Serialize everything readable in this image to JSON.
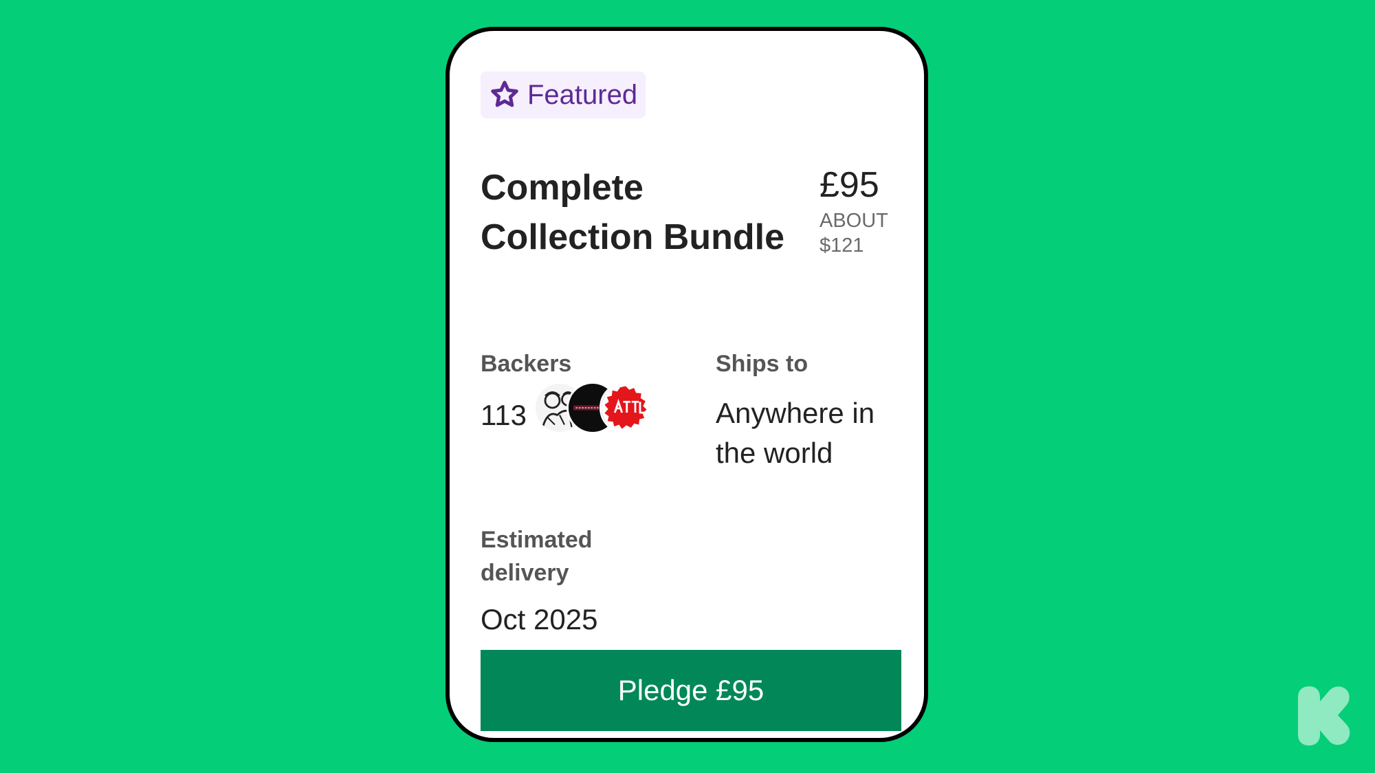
{
  "colors": {
    "background": "#05ce78",
    "card": "#ffffff",
    "badge_bg": "#f6effd",
    "badge_text": "#5e2a94",
    "button": "#028858",
    "logo": "#8fe9c1"
  },
  "reward": {
    "badge": {
      "icon": "star-icon",
      "label": "Featured"
    },
    "title": "Complete Collection Bundle",
    "price": "£95",
    "price_converted": "ABOUT $121",
    "backers": {
      "label": "Backers",
      "count": "113",
      "avatars": [
        "avatar-illustration",
        "avatar-dark-circle",
        "avatar-red-seal"
      ]
    },
    "ships_to": {
      "label": "Ships to",
      "value": "Anywhere in the world"
    },
    "delivery": {
      "label": "Estimated delivery",
      "value": "Oct 2025"
    },
    "pledge_button": "Pledge £95"
  },
  "brand": {
    "logo_icon": "kickstarter-k-logo-icon"
  }
}
